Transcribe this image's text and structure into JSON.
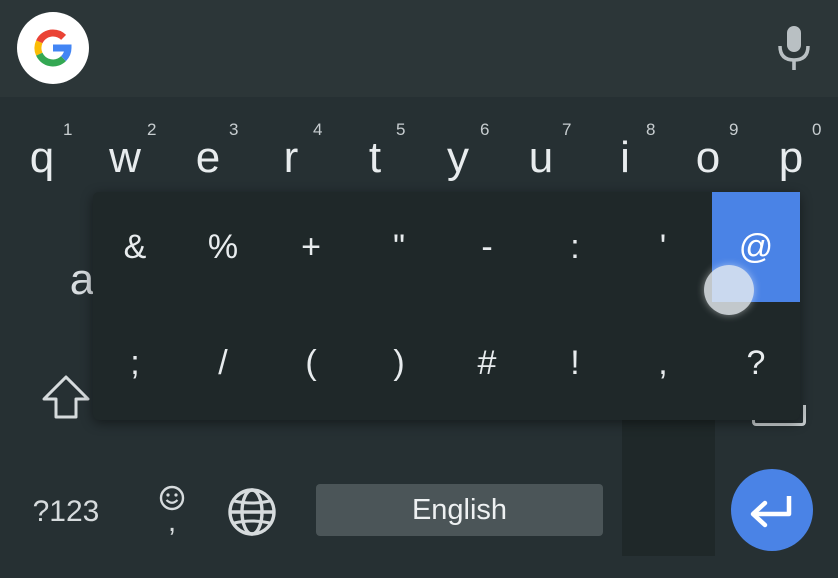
{
  "colors": {
    "background": "#263033",
    "search_bar": "#2c3638",
    "popup": "#1f2829",
    "accent": "#4a83e6",
    "space_key": "#4b5558"
  },
  "search_bar": {
    "logo_icon": "google-g-icon",
    "mic_icon": "microphone-icon"
  },
  "row1": [
    {
      "letter": "q",
      "hint": "1"
    },
    {
      "letter": "w",
      "hint": "2"
    },
    {
      "letter": "e",
      "hint": "3"
    },
    {
      "letter": "r",
      "hint": "4"
    },
    {
      "letter": "t",
      "hint": "5"
    },
    {
      "letter": "y",
      "hint": "6"
    },
    {
      "letter": "u",
      "hint": "7"
    },
    {
      "letter": "i",
      "hint": "8"
    },
    {
      "letter": "o",
      "hint": "9"
    },
    {
      "letter": "p",
      "hint": "0"
    }
  ],
  "row2_partial_letter": "a",
  "popup": {
    "top_row": [
      "&",
      "%",
      "+",
      "\"",
      "-",
      ":",
      "'",
      "@"
    ],
    "bottom_row": [
      ";",
      "/",
      "(",
      ")",
      "#",
      "!",
      ",",
      "?"
    ],
    "selected": "@"
  },
  "bottom_row": {
    "symbols_label": "?123",
    "emoji_icon": "emoji-icon",
    "comma_label": ",",
    "globe_icon": "globe-icon",
    "space_label": "English",
    "enter_icon": "enter-icon"
  },
  "shift_icon": "shift-icon"
}
